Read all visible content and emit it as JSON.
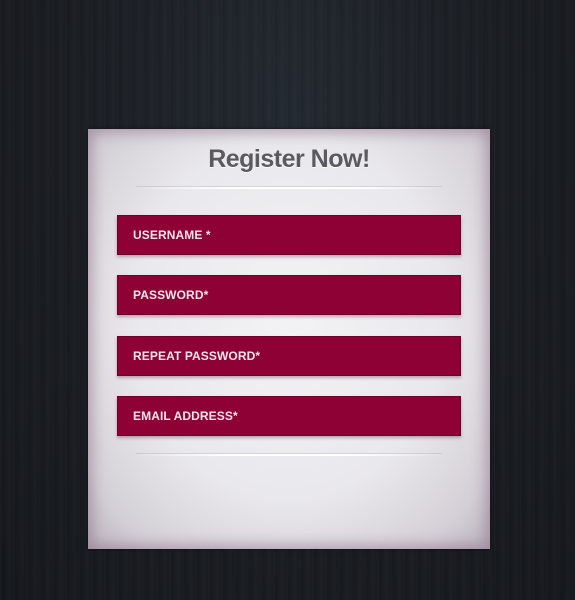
{
  "form": {
    "title": "Register Now!",
    "fields": [
      {
        "placeholder": "USERNAME *",
        "value": ""
      },
      {
        "placeholder": "PASSWORD*",
        "value": ""
      },
      {
        "placeholder": "REPEAT PASSWORD*",
        "value": ""
      },
      {
        "placeholder": "EMAIL ADDRESS*",
        "value": ""
      }
    ]
  },
  "colors": {
    "page_background": "#1b1f24",
    "panel_background": "#e9e8ec",
    "field_background": "#8e0134",
    "field_text": "#f4e6ea",
    "title_text": "#5a5a60"
  }
}
